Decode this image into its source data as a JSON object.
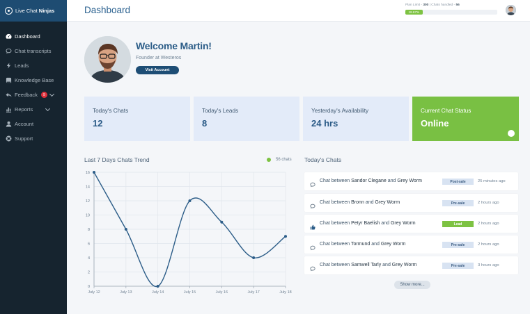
{
  "app": {
    "name_prefix": "Live Chat ",
    "name_bold": "Ninjas"
  },
  "sidebar": {
    "items": [
      {
        "label": "Dashboard",
        "icon": "dashboard-icon",
        "active": true
      },
      {
        "label": "Chat transcripts",
        "icon": "chat-bubble-icon"
      },
      {
        "label": "Leads",
        "icon": "bolt-icon"
      },
      {
        "label": "Knowledge Base",
        "icon": "book-icon"
      },
      {
        "label": "Feedback",
        "icon": "reply-icon",
        "badge": "9"
      },
      {
        "label": "Reports",
        "icon": "bar-chart-icon"
      },
      {
        "label": "Account",
        "icon": "user-icon"
      },
      {
        "label": "Support",
        "icon": "lifebuoy-icon"
      }
    ]
  },
  "header": {
    "title": "Dashboard",
    "plan_limit_label": "Plan Limit - ",
    "plan_limit_value": "300",
    "chats_handled_label": " | Chats handled - ",
    "chats_handled_value": "56",
    "progress_label": "18.67%",
    "progress_fraction": 0.1867
  },
  "profile": {
    "welcome": "Welcome Martin!",
    "subtitle": "Founder at Westeros",
    "visit_button": "Visit Account"
  },
  "stats": [
    {
      "label": "Today's Chats",
      "value": "12"
    },
    {
      "label": "Today's Leads",
      "value": "8"
    },
    {
      "label": "Yesterday's Availability",
      "value": "24 hrs"
    },
    {
      "label": "Current Chat Status",
      "value": "Online"
    }
  ],
  "trend": {
    "title": "Last 7 Days Chats Trend",
    "legend": "56 chats"
  },
  "chart_data": {
    "type": "line",
    "title": "Last 7 Days Chats Trend",
    "categories": [
      "July 12",
      "July 13",
      "July 14",
      "July 15",
      "July 16",
      "July 17",
      "July 18"
    ],
    "series": [
      {
        "name": "56 chats",
        "values": [
          16,
          8,
          0,
          12,
          9,
          4,
          7
        ]
      }
    ],
    "yticks": [
      0,
      2,
      4,
      6,
      8,
      10,
      12,
      14,
      16
    ],
    "ylim": [
      0,
      16
    ],
    "grid": true,
    "legend_position": "top-right",
    "color": "#2c5d88"
  },
  "chats": {
    "title": "Today's Chats",
    "rows": [
      {
        "prefix": "Chat between ",
        "a": "Sandor Clegane",
        "mid": " and ",
        "b": "Grey Worm",
        "tag": "Post-sale",
        "time": "25 minutes ago",
        "icon": "chat-bubble-icon"
      },
      {
        "prefix": "Chat between ",
        "a": "Bronn",
        "mid": " and ",
        "b": "Grey Worm",
        "tag": "Pre-sale",
        "time": "2 hours ago",
        "icon": "chat-bubble-icon"
      },
      {
        "prefix": "Chat between ",
        "a": "Petyr Baelish",
        "mid": " and ",
        "b": "Grey Worm",
        "tag": "Lead",
        "time": "2 hours ago",
        "icon": "thumbs-up-icon"
      },
      {
        "prefix": "Chat between ",
        "a": "Tormund",
        "mid": " and ",
        "b": "Grey Worm",
        "tag": "Pre-sale",
        "time": "2 hours ago",
        "icon": "chat-bubble-icon"
      },
      {
        "prefix": "Chat between ",
        "a": "Samwell Tarly",
        "mid": " and ",
        "b": "Grey Worm",
        "tag": "Pre-sale",
        "time": "3 hours ago",
        "icon": "chat-bubble-icon"
      }
    ],
    "show_more": "Show more..."
  }
}
